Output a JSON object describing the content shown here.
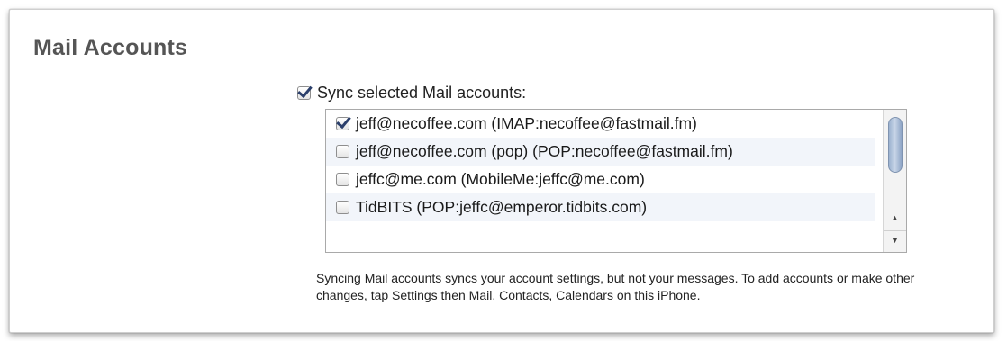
{
  "section": {
    "title": "Mail Accounts"
  },
  "sync": {
    "label": "Sync selected Mail accounts:",
    "checked": true
  },
  "accounts": [
    {
      "label": "jeff@necoffee.com (IMAP:necoffee@fastmail.fm)",
      "checked": true
    },
    {
      "label": "jeff@necoffee.com (pop) (POP:necoffee@fastmail.fm)",
      "checked": false
    },
    {
      "label": "jeffc@me.com (MobileMe:jeffc@me.com)",
      "checked": false
    },
    {
      "label": "TidBITS (POP:jeffc@emperor.tidbits.com)",
      "checked": false
    }
  ],
  "scroll_arrows": {
    "up": "▲",
    "down": "▼"
  },
  "description": "Syncing Mail accounts syncs your account settings, but not your messages. To add accounts or make other changes, tap Settings then Mail, Contacts, Calendars on this iPhone.",
  "colors": {
    "checkmark": "#2b3f6b",
    "row_alt_background": "#f2f5fa",
    "title_text": "#555555",
    "scroll_thumb": "#9bb1cf"
  }
}
